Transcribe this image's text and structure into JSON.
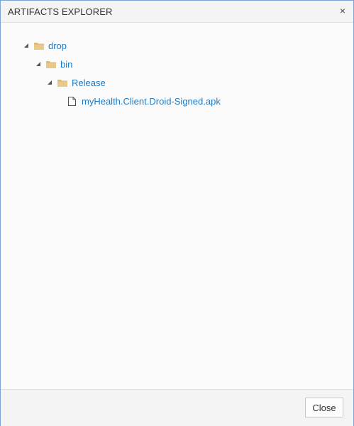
{
  "dialog": {
    "title": "ARTIFACTS EXPLORER",
    "close_glyph": "×"
  },
  "tree": {
    "root": {
      "label": "drop",
      "icon": "folder-icon",
      "expanded": true
    },
    "child": {
      "label": "bin",
      "icon": "folder-icon",
      "expanded": true
    },
    "grandchild": {
      "label": "Release",
      "icon": "folder-icon",
      "expanded": true
    },
    "file": {
      "label": "myHealth.Client.Droid-Signed.apk",
      "icon": "file-icon"
    }
  },
  "footer": {
    "close_label": "Close"
  },
  "colors": {
    "link": "#1f7bc4",
    "folder": "#dcb67a",
    "border_accent": "#7ea3d6"
  }
}
